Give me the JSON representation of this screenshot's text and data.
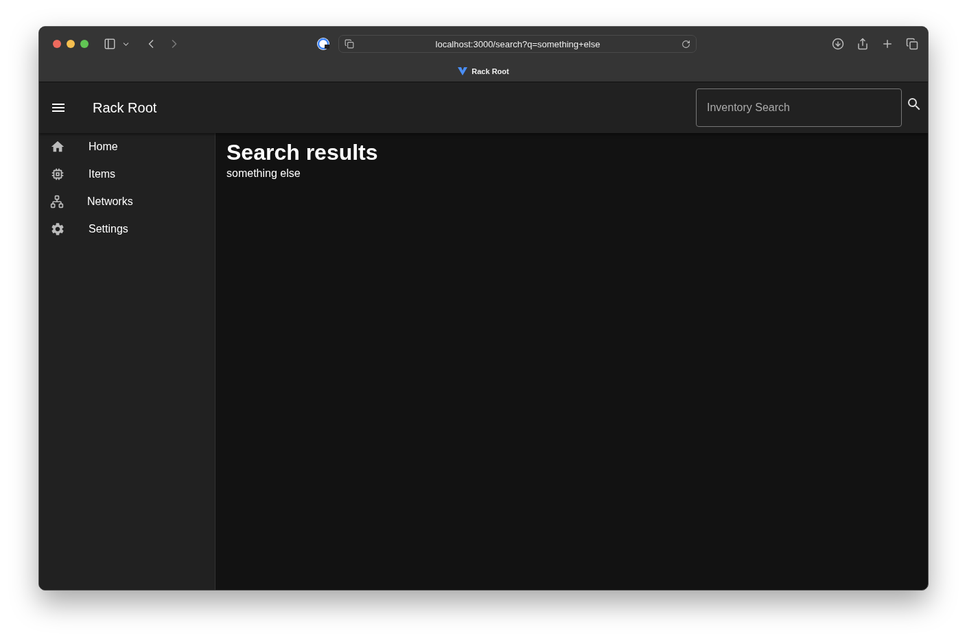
{
  "browser": {
    "url": "localhost:3000/search?q=something+else",
    "tab_title": "Rack Root"
  },
  "app_bar": {
    "title": "Rack Root",
    "search": {
      "placeholder": "Inventory Search"
    }
  },
  "sidebar": {
    "items": [
      {
        "label": "Home",
        "kind": "home"
      },
      {
        "label": "Items",
        "kind": "chip"
      },
      {
        "label": "Networks",
        "kind": "network"
      },
      {
        "label": "Settings",
        "kind": "settings"
      }
    ]
  },
  "main": {
    "heading": "Search results",
    "query": "something else"
  }
}
